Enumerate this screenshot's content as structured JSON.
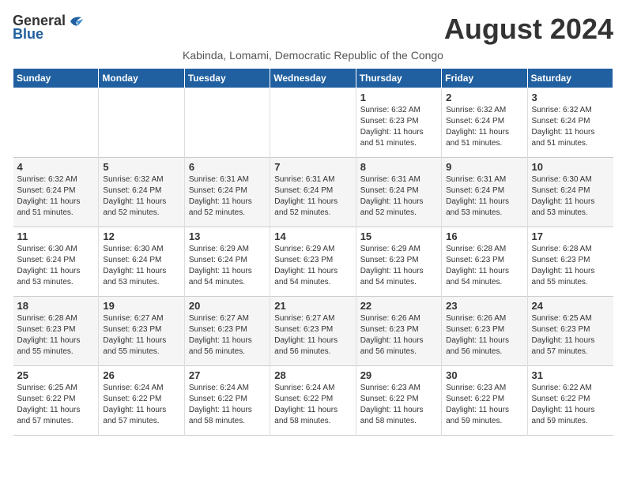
{
  "logo": {
    "general": "General",
    "blue": "Blue"
  },
  "title": "August 2024",
  "subtitle": "Kabinda, Lomami, Democratic Republic of the Congo",
  "headers": [
    "Sunday",
    "Monday",
    "Tuesday",
    "Wednesday",
    "Thursday",
    "Friday",
    "Saturday"
  ],
  "weeks": [
    [
      {
        "day": "",
        "sunrise": "",
        "sunset": "",
        "daylight": ""
      },
      {
        "day": "",
        "sunrise": "",
        "sunset": "",
        "daylight": ""
      },
      {
        "day": "",
        "sunrise": "",
        "sunset": "",
        "daylight": ""
      },
      {
        "day": "",
        "sunrise": "",
        "sunset": "",
        "daylight": ""
      },
      {
        "day": "1",
        "sunrise": "Sunrise: 6:32 AM",
        "sunset": "Sunset: 6:23 PM",
        "daylight": "Daylight: 11 hours and 51 minutes."
      },
      {
        "day": "2",
        "sunrise": "Sunrise: 6:32 AM",
        "sunset": "Sunset: 6:24 PM",
        "daylight": "Daylight: 11 hours and 51 minutes."
      },
      {
        "day": "3",
        "sunrise": "Sunrise: 6:32 AM",
        "sunset": "Sunset: 6:24 PM",
        "daylight": "Daylight: 11 hours and 51 minutes."
      }
    ],
    [
      {
        "day": "4",
        "sunrise": "Sunrise: 6:32 AM",
        "sunset": "Sunset: 6:24 PM",
        "daylight": "Daylight: 11 hours and 51 minutes."
      },
      {
        "day": "5",
        "sunrise": "Sunrise: 6:32 AM",
        "sunset": "Sunset: 6:24 PM",
        "daylight": "Daylight: 11 hours and 52 minutes."
      },
      {
        "day": "6",
        "sunrise": "Sunrise: 6:31 AM",
        "sunset": "Sunset: 6:24 PM",
        "daylight": "Daylight: 11 hours and 52 minutes."
      },
      {
        "day": "7",
        "sunrise": "Sunrise: 6:31 AM",
        "sunset": "Sunset: 6:24 PM",
        "daylight": "Daylight: 11 hours and 52 minutes."
      },
      {
        "day": "8",
        "sunrise": "Sunrise: 6:31 AM",
        "sunset": "Sunset: 6:24 PM",
        "daylight": "Daylight: 11 hours and 52 minutes."
      },
      {
        "day": "9",
        "sunrise": "Sunrise: 6:31 AM",
        "sunset": "Sunset: 6:24 PM",
        "daylight": "Daylight: 11 hours and 53 minutes."
      },
      {
        "day": "10",
        "sunrise": "Sunrise: 6:30 AM",
        "sunset": "Sunset: 6:24 PM",
        "daylight": "Daylight: 11 hours and 53 minutes."
      }
    ],
    [
      {
        "day": "11",
        "sunrise": "Sunrise: 6:30 AM",
        "sunset": "Sunset: 6:24 PM",
        "daylight": "Daylight: 11 hours and 53 minutes."
      },
      {
        "day": "12",
        "sunrise": "Sunrise: 6:30 AM",
        "sunset": "Sunset: 6:24 PM",
        "daylight": "Daylight: 11 hours and 53 minutes."
      },
      {
        "day": "13",
        "sunrise": "Sunrise: 6:29 AM",
        "sunset": "Sunset: 6:24 PM",
        "daylight": "Daylight: 11 hours and 54 minutes."
      },
      {
        "day": "14",
        "sunrise": "Sunrise: 6:29 AM",
        "sunset": "Sunset: 6:23 PM",
        "daylight": "Daylight: 11 hours and 54 minutes."
      },
      {
        "day": "15",
        "sunrise": "Sunrise: 6:29 AM",
        "sunset": "Sunset: 6:23 PM",
        "daylight": "Daylight: 11 hours and 54 minutes."
      },
      {
        "day": "16",
        "sunrise": "Sunrise: 6:28 AM",
        "sunset": "Sunset: 6:23 PM",
        "daylight": "Daylight: 11 hours and 54 minutes."
      },
      {
        "day": "17",
        "sunrise": "Sunrise: 6:28 AM",
        "sunset": "Sunset: 6:23 PM",
        "daylight": "Daylight: 11 hours and 55 minutes."
      }
    ],
    [
      {
        "day": "18",
        "sunrise": "Sunrise: 6:28 AM",
        "sunset": "Sunset: 6:23 PM",
        "daylight": "Daylight: 11 hours and 55 minutes."
      },
      {
        "day": "19",
        "sunrise": "Sunrise: 6:27 AM",
        "sunset": "Sunset: 6:23 PM",
        "daylight": "Daylight: 11 hours and 55 minutes."
      },
      {
        "day": "20",
        "sunrise": "Sunrise: 6:27 AM",
        "sunset": "Sunset: 6:23 PM",
        "daylight": "Daylight: 11 hours and 56 minutes."
      },
      {
        "day": "21",
        "sunrise": "Sunrise: 6:27 AM",
        "sunset": "Sunset: 6:23 PM",
        "daylight": "Daylight: 11 hours and 56 minutes."
      },
      {
        "day": "22",
        "sunrise": "Sunrise: 6:26 AM",
        "sunset": "Sunset: 6:23 PM",
        "daylight": "Daylight: 11 hours and 56 minutes."
      },
      {
        "day": "23",
        "sunrise": "Sunrise: 6:26 AM",
        "sunset": "Sunset: 6:23 PM",
        "daylight": "Daylight: 11 hours and 56 minutes."
      },
      {
        "day": "24",
        "sunrise": "Sunrise: 6:25 AM",
        "sunset": "Sunset: 6:23 PM",
        "daylight": "Daylight: 11 hours and 57 minutes."
      }
    ],
    [
      {
        "day": "25",
        "sunrise": "Sunrise: 6:25 AM",
        "sunset": "Sunset: 6:22 PM",
        "daylight": "Daylight: 11 hours and 57 minutes."
      },
      {
        "day": "26",
        "sunrise": "Sunrise: 6:24 AM",
        "sunset": "Sunset: 6:22 PM",
        "daylight": "Daylight: 11 hours and 57 minutes."
      },
      {
        "day": "27",
        "sunrise": "Sunrise: 6:24 AM",
        "sunset": "Sunset: 6:22 PM",
        "daylight": "Daylight: 11 hours and 58 minutes."
      },
      {
        "day": "28",
        "sunrise": "Sunrise: 6:24 AM",
        "sunset": "Sunset: 6:22 PM",
        "daylight": "Daylight: 11 hours and 58 minutes."
      },
      {
        "day": "29",
        "sunrise": "Sunrise: 6:23 AM",
        "sunset": "Sunset: 6:22 PM",
        "daylight": "Daylight: 11 hours and 58 minutes."
      },
      {
        "day": "30",
        "sunrise": "Sunrise: 6:23 AM",
        "sunset": "Sunset: 6:22 PM",
        "daylight": "Daylight: 11 hours and 59 minutes."
      },
      {
        "day": "31",
        "sunrise": "Sunrise: 6:22 AM",
        "sunset": "Sunset: 6:22 PM",
        "daylight": "Daylight: 11 hours and 59 minutes."
      }
    ]
  ]
}
